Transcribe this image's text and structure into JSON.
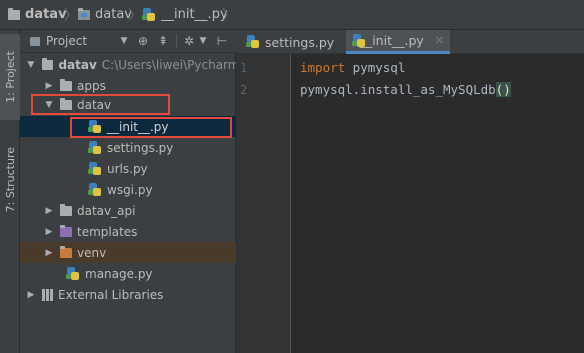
{
  "breadcrumb": {
    "root": "datav",
    "folder": "datav",
    "file": "__init__.py"
  },
  "tool_windows": {
    "project_tab": "1: Project",
    "structure_tab": "7: Structure"
  },
  "project_panel": {
    "view_selector": "Project",
    "tree": {
      "root_label": "datav",
      "root_path": "C:\\Users\\liwei\\Pycharm",
      "items": [
        {
          "label": "apps"
        },
        {
          "label": "datav"
        },
        {
          "label": "__init__.py"
        },
        {
          "label": "settings.py"
        },
        {
          "label": "urls.py"
        },
        {
          "label": "wsgi.py"
        },
        {
          "label": "datav_api"
        },
        {
          "label": "templates"
        },
        {
          "label": "venv"
        },
        {
          "label": "manage.py"
        },
        {
          "label": "External Libraries"
        }
      ]
    }
  },
  "editor": {
    "tabs": [
      {
        "label": "settings.py"
      },
      {
        "label": "__init__.py"
      }
    ],
    "line_numbers": [
      "1",
      "2"
    ],
    "lines": {
      "l1_keyword": "import",
      "l1_module": " pymysql",
      "l2_code": "pymysql.install_as_MySQLdb",
      "l2_parens": "()"
    }
  },
  "colors": {
    "highlight_border": "#e04b3e",
    "selection_bg": "#0d293e",
    "keyword": "#cc7832",
    "active_tab_underline": "#4a88c7"
  },
  "icons": [
    "folder-icon",
    "python-file-icon",
    "settings-icon",
    "collapse-icon",
    "library-icon"
  ]
}
